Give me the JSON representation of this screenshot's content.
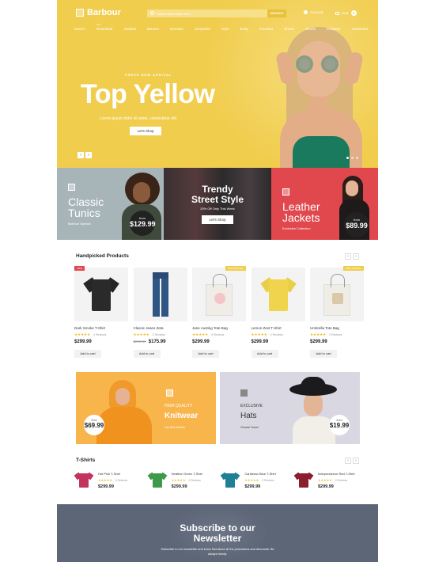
{
  "header": {
    "logo": "Barbour",
    "search_placeholder": "Search entire store here",
    "search_button": "SEARCH",
    "account_label": "Account",
    "cart_label": "Cart",
    "cart_count": "0"
  },
  "nav": {
    "new_tag": "New",
    "items": [
      "New in",
      "Outerwear",
      "Jackets",
      "Blazers",
      "Dresses",
      "Jumpsuits",
      "Tops",
      "Body",
      "Trousers",
      "Shoes",
      "Shorts",
      "Knitwear",
      "Cashmere"
    ]
  },
  "hero": {
    "kicker": "FRESH NEW ARRIVAL",
    "title": "Top Yellow",
    "subtitle": "Lorem ipsum dolor sit amet, consectetur elit.",
    "button": "Let's Shop",
    "prev": "‹",
    "next": "›"
  },
  "promos": [
    {
      "title_line1": "Classic",
      "title_line2": "Tunics",
      "sub": "Barbour Special",
      "price_from": "from",
      "price": "$129.99"
    },
    {
      "title_line1": "Trendy",
      "title_line2": "Street Style",
      "sub": "20% Off Only This Week",
      "button": "Let's Shop"
    },
    {
      "title_line1": "Leather",
      "title_line2": "Jackets",
      "sub": "Exclusive Collection",
      "price_from": "from",
      "price": "$89.99"
    }
  ],
  "handpicked": {
    "title": "Handpicked Products",
    "prev": "‹",
    "next": "›",
    "products": [
      {
        "badge": "-50%",
        "name": "Dark Smoke T-Shirt",
        "stars": "★★★★★",
        "reviews": "0 Reviews",
        "old_price": "",
        "price": "$299.99",
        "button": "Add to cart"
      },
      {
        "badge": "",
        "name": "Classic Jeans Zeta",
        "stars": "★★★★★",
        "reviews": "0 Reviews",
        "old_price": "$299.99",
        "price": "$175.99",
        "button": "Add to cart"
      },
      {
        "badge": "NEW ARRIVAL",
        "name": "Jane Austing Tote Bag",
        "stars": "★★★★★",
        "reviews": "0 Reviews",
        "old_price": "",
        "price": "$299.99",
        "button": "Add to cart"
      },
      {
        "badge": "",
        "name": "Lemon Zest T-Shirt",
        "stars": "★★★★★",
        "reviews": "0 Reviews",
        "old_price": "",
        "price": "$299.99",
        "button": "Add to cart"
      },
      {
        "badge": "NEW ARRIVAL",
        "name": "Umbrella Tote Bag",
        "stars": "★★★★★",
        "reviews": "0 Reviews",
        "old_price": "",
        "price": "$299.99",
        "button": "Add to cart"
      }
    ]
  },
  "banners": [
    {
      "kicker": "HIGH QUALITY",
      "title": "Knitwear",
      "sub": "Top New Models",
      "price_from": "from",
      "price": "$69.99"
    },
    {
      "kicker": "EXCLUSIVE",
      "title": "Hats",
      "sub": "Choose Yours!",
      "price_from": "from",
      "price": "$19.99"
    }
  ],
  "tshirts": {
    "title": "T-Shirts",
    "prev": "‹",
    "next": "›",
    "items": [
      {
        "name": "Hot Pink T-Shirt",
        "stars": "★★★★★",
        "reviews": "0 Reviews",
        "price": "$299.99",
        "color": "#c2345c"
      },
      {
        "name": "Heather Green T-Shirt",
        "stars": "★★★★★",
        "reviews": "0 Reviews",
        "price": "$299.99",
        "color": "#3e9a4a"
      },
      {
        "name": "Carribean Blue T-Shirt",
        "stars": "★★★★★",
        "reviews": "0 Reviews",
        "price": "$299.99",
        "color": "#1e7f95"
      },
      {
        "name": "Independence Red T-Shirt",
        "stars": "★★★★★",
        "reviews": "0 Reviews",
        "price": "$299.99",
        "color": "#8b1e2c"
      }
    ]
  },
  "subscribe": {
    "title_line1": "Subscribe to our",
    "title_line2": "Newsletter",
    "text": "Subscribe to our newsletter and know first about all the promotions and discounts. Be always trendy."
  },
  "colors": {
    "hero_yellow": "#f1cd4e",
    "promo_red": "#e0484e",
    "star": "#f1b91e",
    "subscribe_bg": "#5c6676"
  }
}
